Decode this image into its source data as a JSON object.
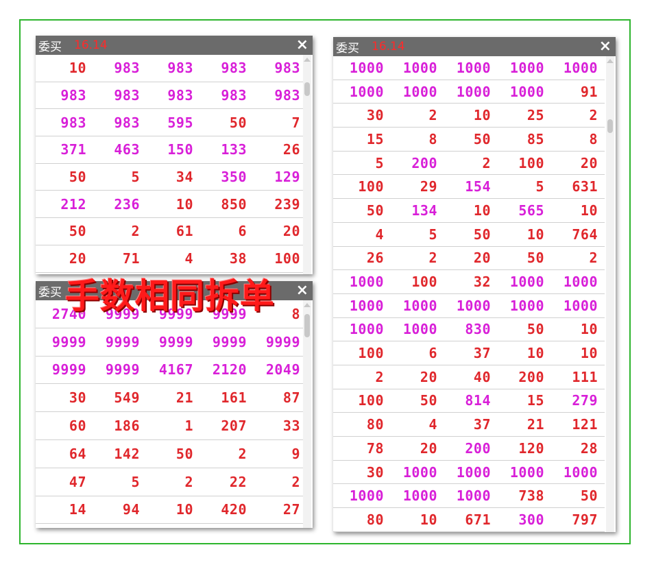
{
  "caption": "手数相同拆单",
  "panels": {
    "top_left": {
      "title": "委买",
      "price": "16.14",
      "close": "×",
      "rows": [
        [
          [
            "10",
            "r"
          ],
          [
            "983",
            "m"
          ],
          [
            "983",
            "m"
          ],
          [
            "983",
            "m"
          ],
          [
            "983",
            "m"
          ]
        ],
        [
          [
            "983",
            "m"
          ],
          [
            "983",
            "m"
          ],
          [
            "983",
            "m"
          ],
          [
            "983",
            "m"
          ],
          [
            "983",
            "m"
          ]
        ],
        [
          [
            "983",
            "m"
          ],
          [
            "983",
            "m"
          ],
          [
            "595",
            "m"
          ],
          [
            "50",
            "r"
          ],
          [
            "7",
            "r"
          ]
        ],
        [
          [
            "371",
            "m"
          ],
          [
            "463",
            "m"
          ],
          [
            "150",
            "m"
          ],
          [
            "133",
            "m"
          ],
          [
            "26",
            "r"
          ]
        ],
        [
          [
            "50",
            "r"
          ],
          [
            "5",
            "r"
          ],
          [
            "34",
            "r"
          ],
          [
            "350",
            "m"
          ],
          [
            "129",
            "m"
          ]
        ],
        [
          [
            "212",
            "m"
          ],
          [
            "236",
            "m"
          ],
          [
            "10",
            "r"
          ],
          [
            "850",
            "r"
          ],
          [
            "239",
            "r"
          ]
        ],
        [
          [
            "50",
            "r"
          ],
          [
            "2",
            "r"
          ],
          [
            "61",
            "r"
          ],
          [
            "6",
            "r"
          ],
          [
            "20",
            "r"
          ]
        ],
        [
          [
            "20",
            "r"
          ],
          [
            "71",
            "r"
          ],
          [
            "4",
            "r"
          ],
          [
            "38",
            "r"
          ],
          [
            "100",
            "r"
          ]
        ]
      ]
    },
    "bottom_left": {
      "title": "委买",
      "close": "×",
      "rows": [
        [
          [
            "2740",
            "m"
          ],
          [
            "9999",
            "m"
          ],
          [
            "9999",
            "m"
          ],
          [
            "9999",
            "m"
          ],
          [
            "8",
            "r"
          ]
        ],
        [
          [
            "9999",
            "m"
          ],
          [
            "9999",
            "m"
          ],
          [
            "9999",
            "m"
          ],
          [
            "9999",
            "m"
          ],
          [
            "9999",
            "m"
          ]
        ],
        [
          [
            "9999",
            "m"
          ],
          [
            "9999",
            "m"
          ],
          [
            "4167",
            "m"
          ],
          [
            "2120",
            "m"
          ],
          [
            "2049",
            "m"
          ]
        ],
        [
          [
            "30",
            "r"
          ],
          [
            "549",
            "r"
          ],
          [
            "21",
            "r"
          ],
          [
            "161",
            "r"
          ],
          [
            "87",
            "r"
          ]
        ],
        [
          [
            "60",
            "r"
          ],
          [
            "186",
            "r"
          ],
          [
            "1",
            "r"
          ],
          [
            "207",
            "r"
          ],
          [
            "33",
            "r"
          ]
        ],
        [
          [
            "64",
            "r"
          ],
          [
            "142",
            "r"
          ],
          [
            "50",
            "r"
          ],
          [
            "2",
            "r"
          ],
          [
            "9",
            "r"
          ]
        ],
        [
          [
            "47",
            "r"
          ],
          [
            "5",
            "r"
          ],
          [
            "2",
            "r"
          ],
          [
            "22",
            "r"
          ],
          [
            "2",
            "r"
          ]
        ],
        [
          [
            "14",
            "r"
          ],
          [
            "94",
            "r"
          ],
          [
            "10",
            "r"
          ],
          [
            "420",
            "r"
          ],
          [
            "27",
            "r"
          ]
        ]
      ]
    },
    "right": {
      "title": "委买",
      "price": "16.14",
      "close": "×",
      "rows": [
        [
          [
            "1000",
            "m"
          ],
          [
            "1000",
            "m"
          ],
          [
            "1000",
            "m"
          ],
          [
            "1000",
            "m"
          ],
          [
            "1000",
            "m"
          ]
        ],
        [
          [
            "1000",
            "m"
          ],
          [
            "1000",
            "m"
          ],
          [
            "1000",
            "m"
          ],
          [
            "1000",
            "m"
          ],
          [
            "91",
            "r"
          ]
        ],
        [
          [
            "30",
            "r"
          ],
          [
            "2",
            "r"
          ],
          [
            "10",
            "r"
          ],
          [
            "25",
            "r"
          ],
          [
            "2",
            "r"
          ]
        ],
        [
          [
            "15",
            "r"
          ],
          [
            "8",
            "r"
          ],
          [
            "50",
            "r"
          ],
          [
            "85",
            "r"
          ],
          [
            "8",
            "r"
          ]
        ],
        [
          [
            "5",
            "r"
          ],
          [
            "200",
            "m"
          ],
          [
            "2",
            "r"
          ],
          [
            "100",
            "r"
          ],
          [
            "20",
            "r"
          ]
        ],
        [
          [
            "100",
            "r"
          ],
          [
            "29",
            "r"
          ],
          [
            "154",
            "m"
          ],
          [
            "5",
            "r"
          ],
          [
            "631",
            "r"
          ]
        ],
        [
          [
            "50",
            "r"
          ],
          [
            "134",
            "m"
          ],
          [
            "10",
            "r"
          ],
          [
            "565",
            "m"
          ],
          [
            "10",
            "r"
          ]
        ],
        [
          [
            "4",
            "r"
          ],
          [
            "5",
            "r"
          ],
          [
            "50",
            "r"
          ],
          [
            "10",
            "r"
          ],
          [
            "764",
            "r"
          ]
        ],
        [
          [
            "26",
            "r"
          ],
          [
            "2",
            "r"
          ],
          [
            "20",
            "r"
          ],
          [
            "50",
            "r"
          ],
          [
            "2",
            "r"
          ]
        ],
        [
          [
            "1000",
            "m"
          ],
          [
            "100",
            "r"
          ],
          [
            "32",
            "r"
          ],
          [
            "1000",
            "m"
          ],
          [
            "1000",
            "m"
          ]
        ],
        [
          [
            "1000",
            "m"
          ],
          [
            "1000",
            "m"
          ],
          [
            "1000",
            "m"
          ],
          [
            "1000",
            "m"
          ],
          [
            "1000",
            "m"
          ]
        ],
        [
          [
            "1000",
            "m"
          ],
          [
            "1000",
            "m"
          ],
          [
            "830",
            "m"
          ],
          [
            "50",
            "r"
          ],
          [
            "10",
            "r"
          ]
        ],
        [
          [
            "100",
            "r"
          ],
          [
            "6",
            "r"
          ],
          [
            "37",
            "r"
          ],
          [
            "10",
            "r"
          ],
          [
            "10",
            "r"
          ]
        ],
        [
          [
            "2",
            "r"
          ],
          [
            "20",
            "r"
          ],
          [
            "40",
            "r"
          ],
          [
            "200",
            "r"
          ],
          [
            "111",
            "r"
          ]
        ],
        [
          [
            "100",
            "r"
          ],
          [
            "50",
            "r"
          ],
          [
            "814",
            "m"
          ],
          [
            "15",
            "r"
          ],
          [
            "279",
            "m"
          ]
        ],
        [
          [
            "80",
            "r"
          ],
          [
            "4",
            "r"
          ],
          [
            "37",
            "r"
          ],
          [
            "21",
            "r"
          ],
          [
            "121",
            "r"
          ]
        ],
        [
          [
            "78",
            "r"
          ],
          [
            "20",
            "r"
          ],
          [
            "200",
            "m"
          ],
          [
            "120",
            "r"
          ],
          [
            "28",
            "r"
          ]
        ],
        [
          [
            "30",
            "r"
          ],
          [
            "1000",
            "m"
          ],
          [
            "1000",
            "m"
          ],
          [
            "1000",
            "m"
          ],
          [
            "1000",
            "m"
          ]
        ],
        [
          [
            "1000",
            "m"
          ],
          [
            "1000",
            "m"
          ],
          [
            "1000",
            "m"
          ],
          [
            "738",
            "r"
          ],
          [
            "50",
            "r"
          ]
        ],
        [
          [
            "80",
            "r"
          ],
          [
            "10",
            "r"
          ],
          [
            "671",
            "r"
          ],
          [
            "300",
            "m"
          ],
          [
            "797",
            "r"
          ]
        ]
      ]
    }
  },
  "colors": {
    "red": "#e0272c",
    "magenta": "#d81fd8",
    "price": "#ff2a2a",
    "frame": "#2db52d",
    "titlebar": "#6b6b6b"
  },
  "icons": {
    "close": "close-icon"
  }
}
